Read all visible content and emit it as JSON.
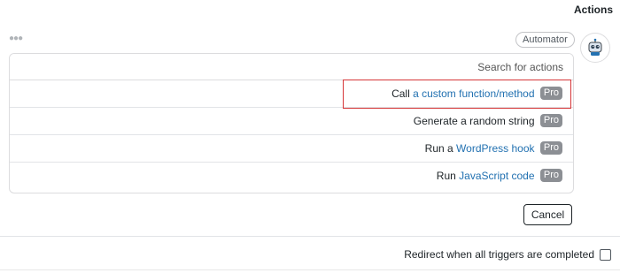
{
  "header": {
    "title": "Actions"
  },
  "menu_icon": "ellipsis-icon",
  "badge": {
    "label": "Automator"
  },
  "avatar_icon": "robot-icon",
  "search": {
    "placeholder": "Search for actions"
  },
  "actions": [
    {
      "prefix": "Call",
      "link": "a custom function/method",
      "suffix": "",
      "pro": "Pro",
      "highlighted": true
    },
    {
      "prefix": "Generate a random string",
      "link": "",
      "suffix": "",
      "pro": "Pro",
      "highlighted": false
    },
    {
      "prefix": "Run a",
      "link": "WordPress hook",
      "suffix": "",
      "pro": "Pro",
      "highlighted": false
    },
    {
      "prefix": "Run",
      "link": "JavaScript code",
      "suffix": "",
      "pro": "Pro",
      "highlighted": false
    }
  ],
  "cancel_label": "Cancel",
  "redirect": {
    "label": "Redirect when all triggers are completed",
    "checked": false
  },
  "colors": {
    "link": "#2271b1",
    "highlight_border": "#d63638",
    "pro_badge": "#8c8f94"
  }
}
